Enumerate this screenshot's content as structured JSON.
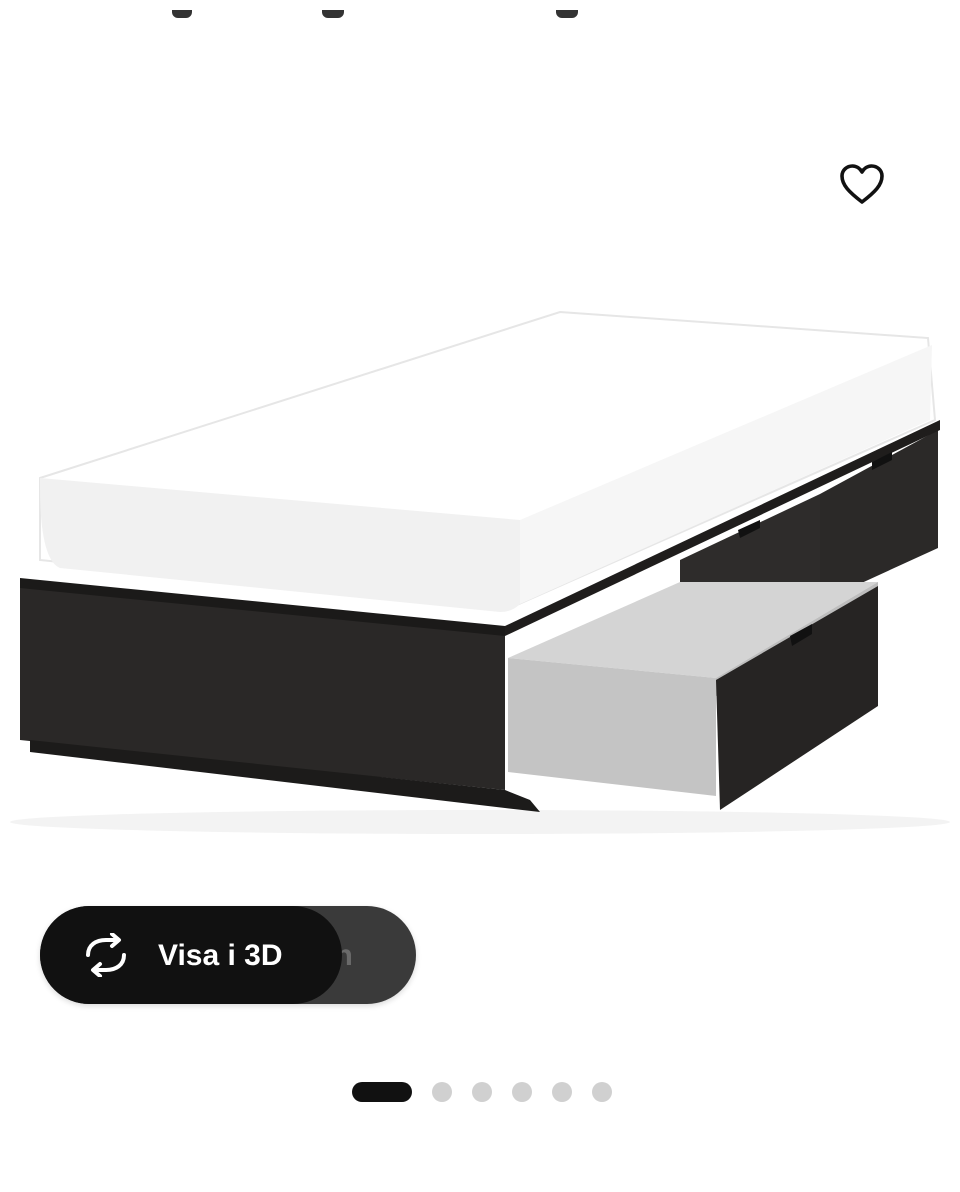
{
  "favorite": {
    "icon": "heart-icon",
    "state": "not-favorited"
  },
  "product_image": {
    "alt": ""
  },
  "view3d": {
    "label": "Visa i 3D",
    "overlapped_label": "stilen",
    "icon": "rotate-3d-icon"
  },
  "carousel": {
    "slide_count": 6,
    "active_index": 0,
    "active_color": "#111111",
    "inactive_color": "#d0d0d0"
  }
}
